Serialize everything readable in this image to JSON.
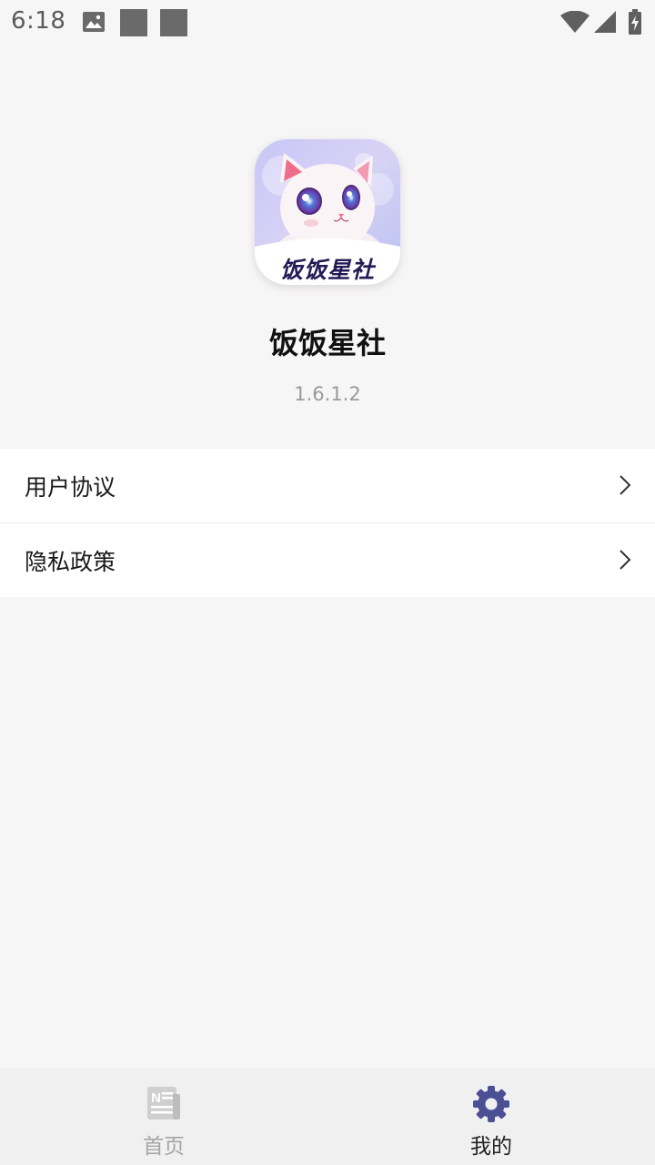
{
  "status_bar": {
    "time": "6:18",
    "icons": [
      "image-icon",
      "notification-square-icon",
      "notification-square-icon",
      "wifi-icon",
      "signal-icon",
      "battery-charging-icon"
    ]
  },
  "app": {
    "logo_text": "饭饭星社",
    "name": "饭饭星社",
    "version": "1.6.1.2"
  },
  "menu": {
    "items": [
      {
        "label": "用户协议",
        "icon": "chevron-right-icon"
      },
      {
        "label": "隐私政策",
        "icon": "chevron-right-icon"
      }
    ]
  },
  "tab_bar": {
    "tabs": [
      {
        "label": "首页",
        "icon": "newspaper-icon",
        "active": false
      },
      {
        "label": "我的",
        "icon": "gear-icon",
        "active": true
      }
    ],
    "active_color": "#4b4f94",
    "inactive_color": "#a5a5a5"
  }
}
